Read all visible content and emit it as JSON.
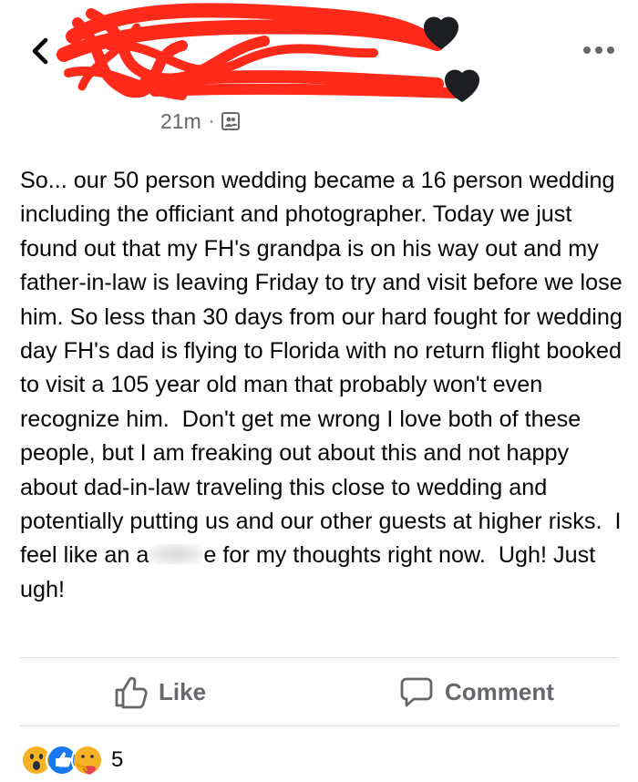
{
  "header": {
    "timestamp": "21m",
    "separator": "·",
    "audience_icon": "friends-icon"
  },
  "post": {
    "text_before": "So... our 50 person wedding became a 16 person wedding including the officiant and photographer. Today we just found out that my FH's grandpa is on his way out and my father-in-law is leaving Friday to try and visit before we lose him. So less than 30 days from our hard fought for wedding day FH's dad is flying to Florida with no return flight booked to visit a 105 year old man that probably won't even recognize him.  Don't get me wrong I love both of these people, but I am freaking out about this and not happy about dad-in-law traveling this close to wedding and potentially putting us and our other guests at higher risks.  I feel like an a",
    "text_after": "e for my thoughts right now.  Ugh! Just ugh!"
  },
  "actions": {
    "like_label": "Like",
    "comment_label": "Comment"
  },
  "reactions": {
    "icons": [
      "wow-reaction-icon",
      "like-reaction-icon",
      "care-reaction-icon"
    ],
    "count": "5"
  },
  "colors": {
    "redaction": "#ff2a1a",
    "secondary_text": "#65676b",
    "like_blue": "#1877f2",
    "divider": "#dadde1"
  }
}
